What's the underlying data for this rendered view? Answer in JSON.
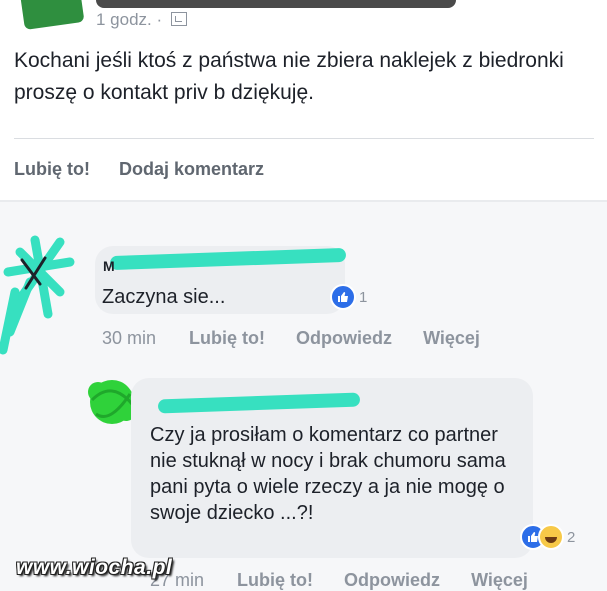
{
  "post": {
    "time": "1 godz. ·",
    "text": "Kochani jeśli ktoś z państwa nie zbiera naklejek z biedronki proszę o kontakt priv b dziękuję.",
    "like_label": "Lubię to!",
    "comment_label": "Dodaj komentarz"
  },
  "comment1": {
    "initial": "M",
    "text": "Zaczyna sie...",
    "reaction_count": "1",
    "time": "30 min",
    "like_label": "Lubię to!",
    "reply_label": "Odpowiedz",
    "more_label": "Więcej"
  },
  "comment2": {
    "text": "Czy ja prosiłam o komentarz co partner nie stuknął w nocy i brak chumoru sama pani pyta o wiele rzeczy a ja nie mogę o swoje dziecko ...?!",
    "reaction_count": "2",
    "time": "27 min",
    "like_label": "Lubię to!",
    "reply_label": "Odpowiedz",
    "more_label": "Więcej"
  },
  "watermark": "www.wiocha.pl",
  "colors": {
    "like_blue": "#2d6ee8",
    "censor_teal": "#37e0c0",
    "censor_green": "#2fd23a",
    "meta_gray": "#8d949e"
  },
  "icons": [
    "audience-icon",
    "like-icon",
    "haha-icon"
  ]
}
